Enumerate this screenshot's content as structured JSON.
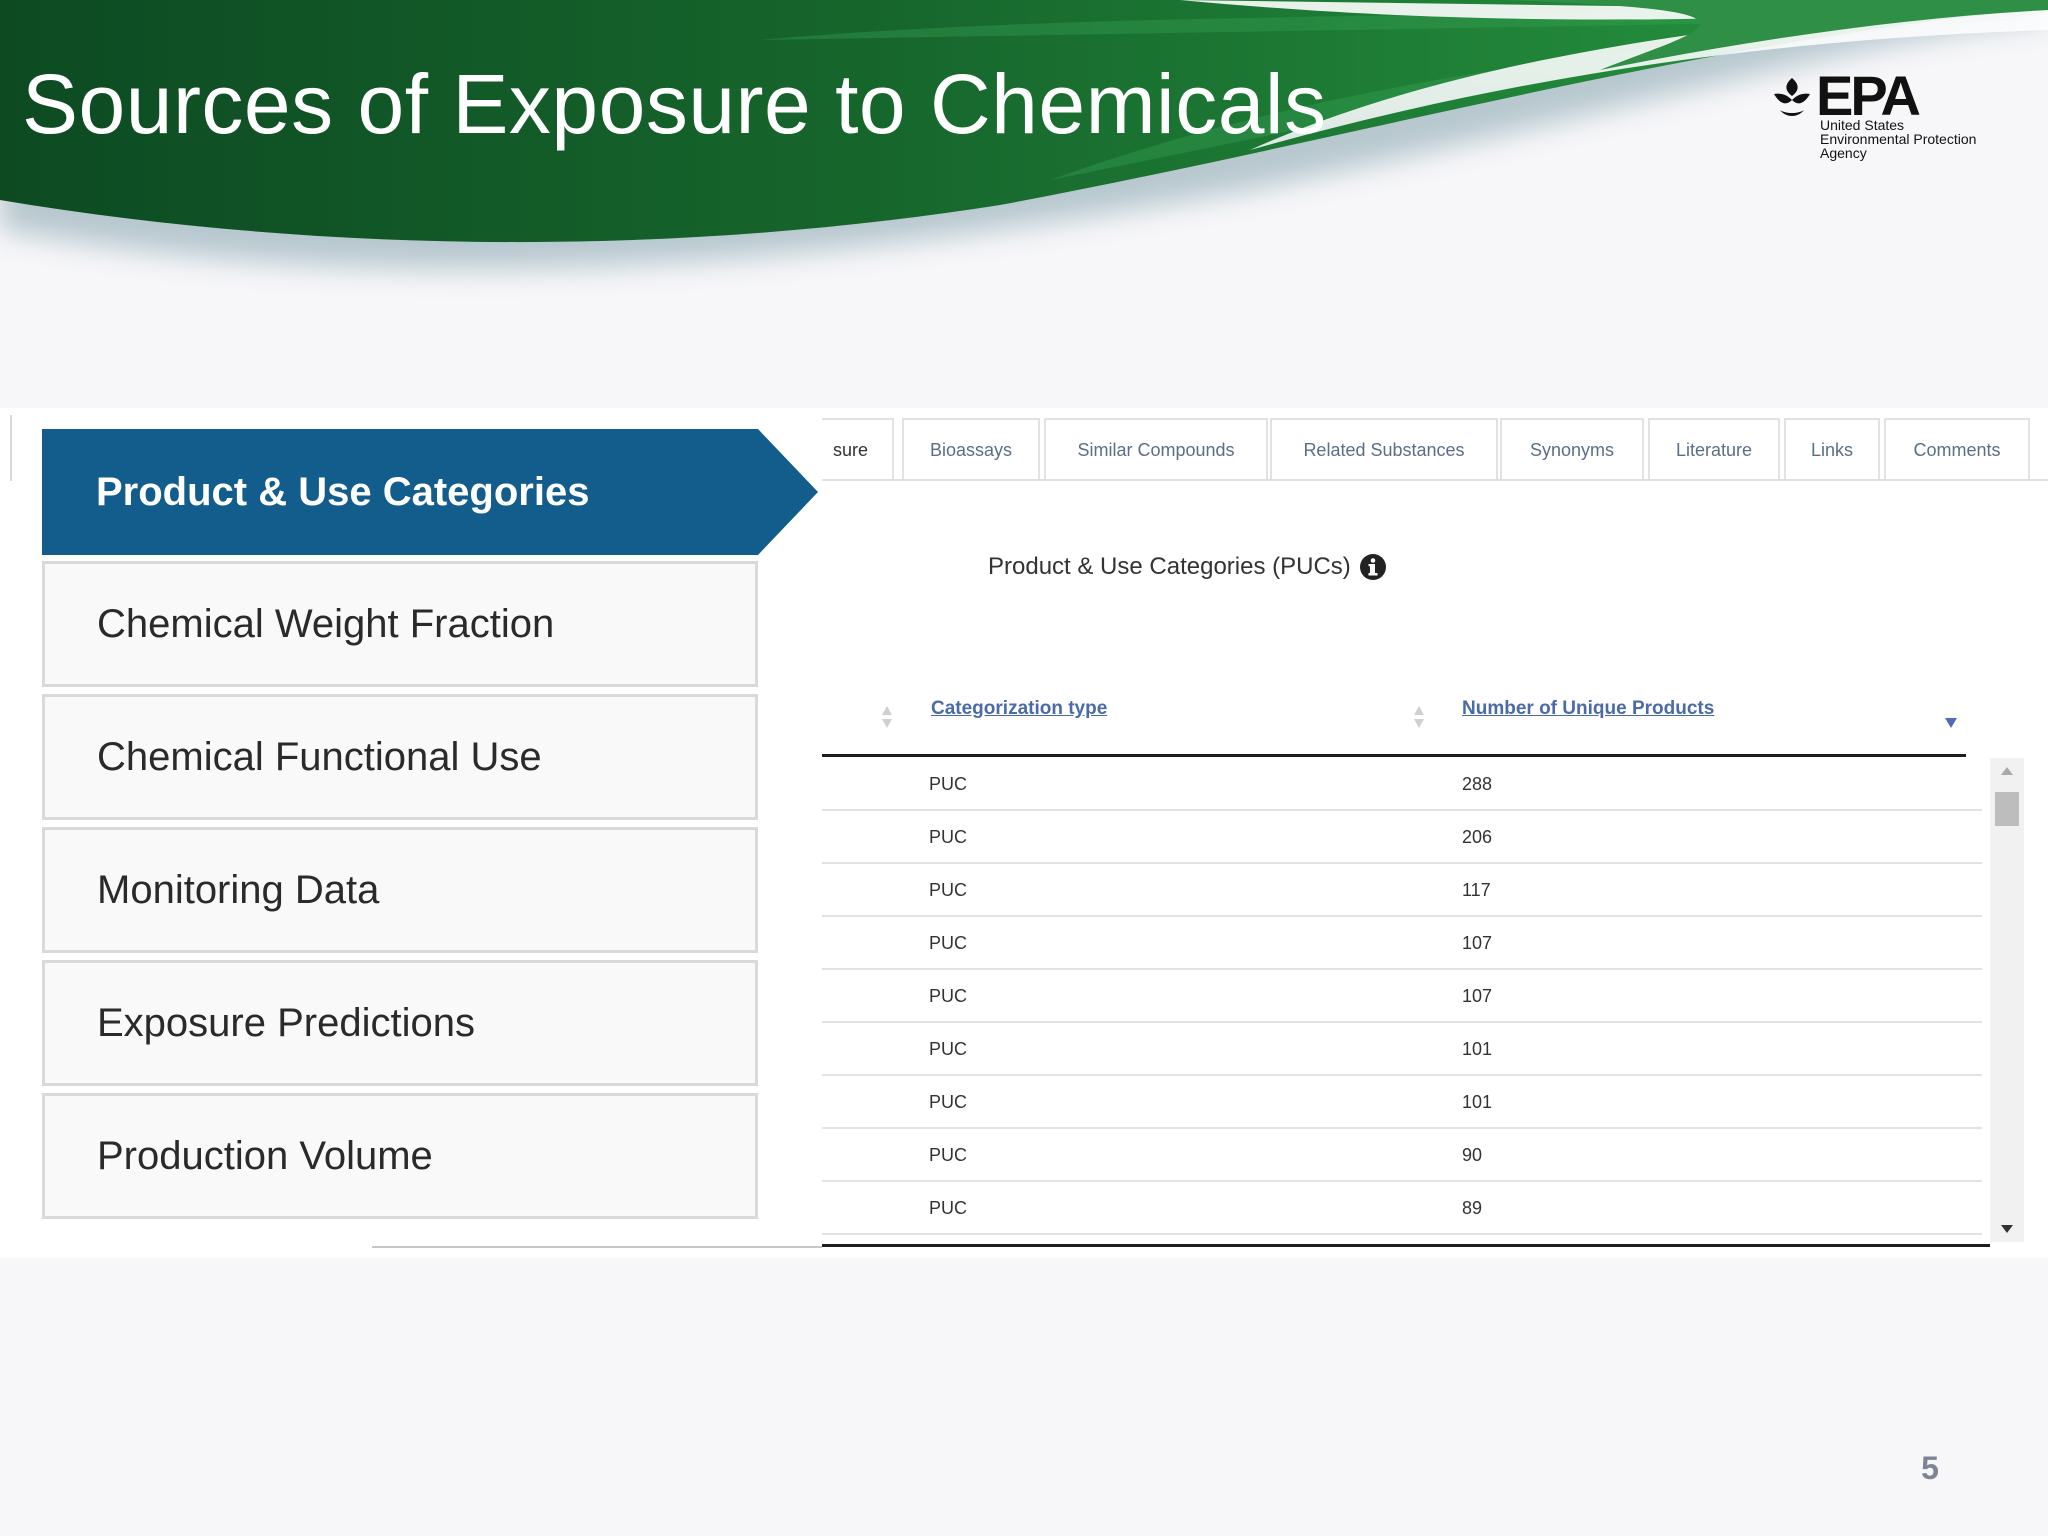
{
  "slide": {
    "title": "Sources of Exposure to Chemicals",
    "page_number": "5",
    "logo": {
      "wordmark": "EPA",
      "line1": "United States",
      "line2": "Environmental Protection",
      "line3": "Agency"
    }
  },
  "colors": {
    "header_green_dark": "#0d4a22",
    "header_green": "#1f7d35",
    "nav_active_bg": "#135d8c",
    "nav_border": "#d9d9d9",
    "link_blue": "#4a6aa8",
    "tab_text": "#5a6f87"
  },
  "left_nav": {
    "active_label": "Product & Use Categories",
    "items": [
      "Chemical Weight Fraction",
      "Chemical Functional Use",
      "Monitoring Data",
      "Exposure Predictions",
      "Production Volume"
    ]
  },
  "tabs": {
    "partial": "sure",
    "items": [
      "Bioassays",
      "Similar Compounds",
      "Related Substances",
      "Synonyms",
      "Literature",
      "Links",
      "Comments"
    ]
  },
  "section": {
    "heading": "Product & Use Categories (PUCs)",
    "info_icon": "info-circle-icon"
  },
  "table": {
    "columns": [
      "Categorization type",
      "Number of Unique Products"
    ],
    "rows": [
      [
        "PUC",
        "288"
      ],
      [
        "PUC",
        "206"
      ],
      [
        "PUC",
        "117"
      ],
      [
        "PUC",
        "107"
      ],
      [
        "PUC",
        "107"
      ],
      [
        "PUC",
        "101"
      ],
      [
        "PUC",
        "101"
      ],
      [
        "PUC",
        "90"
      ],
      [
        "PUC",
        "89"
      ]
    ],
    "sort": {
      "column": "Number of Unique Products",
      "direction": "descending"
    }
  }
}
